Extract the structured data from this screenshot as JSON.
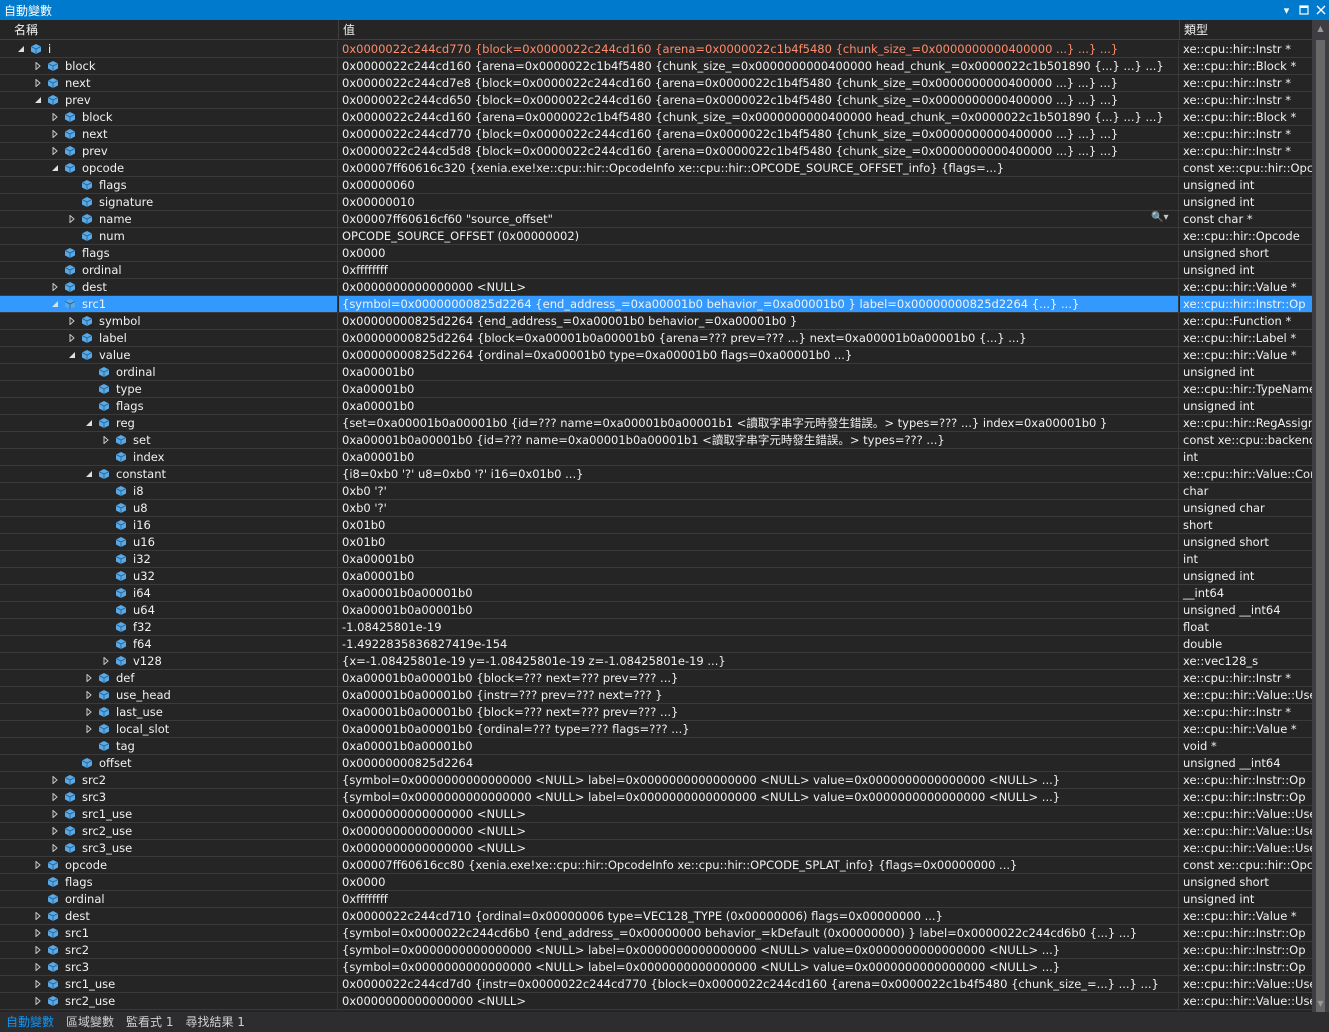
{
  "window": {
    "title": "自動變數",
    "dropdown_glyph": "▾",
    "restore_glyph": "▢",
    "close_glyph": "✕"
  },
  "columns": {
    "name": "名稱",
    "value": "值",
    "type": "類型"
  },
  "tabs": [
    {
      "label": "自動變數",
      "active": true
    },
    {
      "label": "區域變數",
      "active": false
    },
    {
      "label": "監看式 1",
      "active": false
    },
    {
      "label": "尋找結果 1",
      "active": false
    }
  ],
  "rows": [
    {
      "depth": 0,
      "exp": "open",
      "name": "i",
      "value": "0x0000022c244cd770 {block=0x0000022c244cd160 {arena=0x0000022c1b4f5480 {chunk_size_=0x0000000000400000 ...} ...} ...}",
      "type": "xe::cpu::hir::Instr *",
      "hl": true
    },
    {
      "depth": 1,
      "exp": "closed",
      "name": "block",
      "value": "0x0000022c244cd160 {arena=0x0000022c1b4f5480 {chunk_size_=0x0000000000400000 head_chunk_=0x0000022c1b501890 {...} ...} ...}",
      "type": "xe::cpu::hir::Block *"
    },
    {
      "depth": 1,
      "exp": "closed",
      "name": "next",
      "value": "0x0000022c244cd7e8 {block=0x0000022c244cd160 {arena=0x0000022c1b4f5480 {chunk_size_=0x0000000000400000 ...} ...} ...}",
      "type": "xe::cpu::hir::Instr *"
    },
    {
      "depth": 1,
      "exp": "open",
      "name": "prev",
      "value": "0x0000022c244cd650 {block=0x0000022c244cd160 {arena=0x0000022c1b4f5480 {chunk_size_=0x0000000000400000 ...} ...} ...}",
      "type": "xe::cpu::hir::Instr *"
    },
    {
      "depth": 2,
      "exp": "closed",
      "name": "block",
      "value": "0x0000022c244cd160 {arena=0x0000022c1b4f5480 {chunk_size_=0x0000000000400000 head_chunk_=0x0000022c1b501890 {...} ...} ...}",
      "type": "xe::cpu::hir::Block *"
    },
    {
      "depth": 2,
      "exp": "closed",
      "name": "next",
      "value": "0x0000022c244cd770 {block=0x0000022c244cd160 {arena=0x0000022c1b4f5480 {chunk_size_=0x0000000000400000 ...} ...} ...}",
      "type": "xe::cpu::hir::Instr *"
    },
    {
      "depth": 2,
      "exp": "closed",
      "name": "prev",
      "value": "0x0000022c244cd5d8 {block=0x0000022c244cd160 {arena=0x0000022c1b4f5480 {chunk_size_=0x0000000000400000 ...} ...} ...}",
      "type": "xe::cpu::hir::Instr *"
    },
    {
      "depth": 2,
      "exp": "open",
      "name": "opcode",
      "value": "0x00007ff60616c320 {xenia.exe!xe::cpu::hir::OpcodeInfo xe::cpu::hir::OPCODE_SOURCE_OFFSET_info} {flags=...}",
      "type": "const xe::cpu::hir::Opco"
    },
    {
      "depth": 3,
      "exp": "none",
      "name": "flags",
      "value": "0x00000060",
      "type": "unsigned int"
    },
    {
      "depth": 3,
      "exp": "none",
      "name": "signature",
      "value": "0x00000010",
      "type": "unsigned int"
    },
    {
      "depth": 3,
      "exp": "closed",
      "name": "name",
      "value": "0x00007ff60616cf60 \"source_offset\"",
      "type": "const char *",
      "mag": "🔍▾"
    },
    {
      "depth": 3,
      "exp": "none",
      "name": "num",
      "value": "OPCODE_SOURCE_OFFSET (0x00000002)",
      "type": "xe::cpu::hir::Opcode"
    },
    {
      "depth": 2,
      "exp": "none",
      "name": "flags",
      "value": "0x0000",
      "type": "unsigned short"
    },
    {
      "depth": 2,
      "exp": "none",
      "name": "ordinal",
      "value": "0xffffffff",
      "type": "unsigned int"
    },
    {
      "depth": 2,
      "exp": "closed",
      "name": "dest",
      "value": "0x0000000000000000 <NULL>",
      "type": "xe::cpu::hir::Value *"
    },
    {
      "depth": 2,
      "exp": "open",
      "name": "src1",
      "value": "{symbol=0x00000000825d2264 {end_address_=0xa00001b0 behavior_=0xa00001b0 } label=0x00000000825d2264 {...} ...}",
      "type": "xe::cpu::hir::Instr::Op",
      "sel": true
    },
    {
      "depth": 3,
      "exp": "closed",
      "name": "symbol",
      "value": "0x00000000825d2264 {end_address_=0xa00001b0 behavior_=0xa00001b0 }",
      "type": "xe::cpu::Function *"
    },
    {
      "depth": 3,
      "exp": "closed",
      "name": "label",
      "value": "0x00000000825d2264 {block=0xa00001b0a00001b0 {arena=??? prev=??? ...} next=0xa00001b0a00001b0 {...} ...}",
      "type": "xe::cpu::hir::Label *"
    },
    {
      "depth": 3,
      "exp": "open",
      "name": "value",
      "value": "0x00000000825d2264 {ordinal=0xa00001b0 type=0xa00001b0 flags=0xa00001b0 ...}",
      "type": "xe::cpu::hir::Value *"
    },
    {
      "depth": 4,
      "exp": "none",
      "name": "ordinal",
      "value": "0xa00001b0",
      "type": "unsigned int"
    },
    {
      "depth": 4,
      "exp": "none",
      "name": "type",
      "value": "0xa00001b0",
      "type": "xe::cpu::hir::TypeName"
    },
    {
      "depth": 4,
      "exp": "none",
      "name": "flags",
      "value": "0xa00001b0",
      "type": "unsigned int"
    },
    {
      "depth": 4,
      "exp": "open",
      "name": "reg",
      "value": "{set=0xa00001b0a00001b0 {id=??? name=0xa00001b0a00001b1 <讀取字串字元時發生錯誤。> types=??? ...} index=0xa00001b0 }",
      "type": "xe::cpu::hir::RegAssignm"
    },
    {
      "depth": 5,
      "exp": "closed",
      "name": "set",
      "value": "0xa00001b0a00001b0 {id=??? name=0xa00001b0a00001b1 <讀取字串字元時發生錯誤。> types=??? ...}",
      "type": "const xe::cpu::backend::"
    },
    {
      "depth": 5,
      "exp": "none",
      "name": "index",
      "value": "0xa00001b0",
      "type": "int"
    },
    {
      "depth": 4,
      "exp": "open",
      "name": "constant",
      "value": "{i8=0xb0 '?' u8=0xb0 '?' i16=0x01b0 ...}",
      "type": "xe::cpu::hir::Value::Const"
    },
    {
      "depth": 5,
      "exp": "none",
      "name": "i8",
      "value": "0xb0 '?'",
      "type": "char"
    },
    {
      "depth": 5,
      "exp": "none",
      "name": "u8",
      "value": "0xb0 '?'",
      "type": "unsigned char"
    },
    {
      "depth": 5,
      "exp": "none",
      "name": "i16",
      "value": "0x01b0",
      "type": "short"
    },
    {
      "depth": 5,
      "exp": "none",
      "name": "u16",
      "value": "0x01b0",
      "type": "unsigned short"
    },
    {
      "depth": 5,
      "exp": "none",
      "name": "i32",
      "value": "0xa00001b0",
      "type": "int"
    },
    {
      "depth": 5,
      "exp": "none",
      "name": "u32",
      "value": "0xa00001b0",
      "type": "unsigned int"
    },
    {
      "depth": 5,
      "exp": "none",
      "name": "i64",
      "value": "0xa00001b0a00001b0",
      "type": "__int64"
    },
    {
      "depth": 5,
      "exp": "none",
      "name": "u64",
      "value": "0xa00001b0a00001b0",
      "type": "unsigned __int64"
    },
    {
      "depth": 5,
      "exp": "none",
      "name": "f32",
      "value": "-1.08425801e-19",
      "type": "float"
    },
    {
      "depth": 5,
      "exp": "none",
      "name": "f64",
      "value": "-1.4922835836827419e-154",
      "type": "double"
    },
    {
      "depth": 5,
      "exp": "closed",
      "name": "v128",
      "value": "{x=-1.08425801e-19 y=-1.08425801e-19 z=-1.08425801e-19 ...}",
      "type": "xe::vec128_s"
    },
    {
      "depth": 4,
      "exp": "closed",
      "name": "def",
      "value": "0xa00001b0a00001b0 {block=??? next=??? prev=??? ...}",
      "type": "xe::cpu::hir::Instr *"
    },
    {
      "depth": 4,
      "exp": "closed",
      "name": "use_head",
      "value": "0xa00001b0a00001b0 {instr=??? prev=??? next=??? }",
      "type": "xe::cpu::hir::Value::Use_s"
    },
    {
      "depth": 4,
      "exp": "closed",
      "name": "last_use",
      "value": "0xa00001b0a00001b0 {block=??? next=??? prev=??? ...}",
      "type": "xe::cpu::hir::Instr *"
    },
    {
      "depth": 4,
      "exp": "closed",
      "name": "local_slot",
      "value": "0xa00001b0a00001b0 {ordinal=??? type=??? flags=??? ...}",
      "type": "xe::cpu::hir::Value *"
    },
    {
      "depth": 4,
      "exp": "none",
      "name": "tag",
      "value": "0xa00001b0a00001b0",
      "type": "void *"
    },
    {
      "depth": 3,
      "exp": "none",
      "name": "offset",
      "value": "0x00000000825d2264",
      "type": "unsigned __int64"
    },
    {
      "depth": 2,
      "exp": "closed",
      "name": "src2",
      "value": "{symbol=0x0000000000000000 <NULL> label=0x0000000000000000 <NULL> value=0x0000000000000000 <NULL> ...}",
      "type": "xe::cpu::hir::Instr::Op"
    },
    {
      "depth": 2,
      "exp": "closed",
      "name": "src3",
      "value": "{symbol=0x0000000000000000 <NULL> label=0x0000000000000000 <NULL> value=0x0000000000000000 <NULL> ...}",
      "type": "xe::cpu::hir::Instr::Op"
    },
    {
      "depth": 2,
      "exp": "closed",
      "name": "src1_use",
      "value": "0x0000000000000000 <NULL>",
      "type": "xe::cpu::hir::Value::Use_s"
    },
    {
      "depth": 2,
      "exp": "closed",
      "name": "src2_use",
      "value": "0x0000000000000000 <NULL>",
      "type": "xe::cpu::hir::Value::Use_s"
    },
    {
      "depth": 2,
      "exp": "closed",
      "name": "src3_use",
      "value": "0x0000000000000000 <NULL>",
      "type": "xe::cpu::hir::Value::Use_s"
    },
    {
      "depth": 1,
      "exp": "closed",
      "name": "opcode",
      "value": "0x00007ff60616cc80 {xenia.exe!xe::cpu::hir::OpcodeInfo xe::cpu::hir::OPCODE_SPLAT_info} {flags=0x00000000 ...}",
      "type": "const xe::cpu::hir::Opco"
    },
    {
      "depth": 1,
      "exp": "none",
      "name": "flags",
      "value": "0x0000",
      "type": "unsigned short"
    },
    {
      "depth": 1,
      "exp": "none",
      "name": "ordinal",
      "value": "0xffffffff",
      "type": "unsigned int"
    },
    {
      "depth": 1,
      "exp": "closed",
      "name": "dest",
      "value": "0x0000022c244cd710 {ordinal=0x00000006 type=VEC128_TYPE (0x00000006) flags=0x00000000 ...}",
      "type": "xe::cpu::hir::Value *"
    },
    {
      "depth": 1,
      "exp": "closed",
      "name": "src1",
      "value": "{symbol=0x0000022c244cd6b0 {end_address_=0x00000000 behavior_=kDefault (0x00000000) } label=0x0000022c244cd6b0 {...} ...}",
      "type": "xe::cpu::hir::Instr::Op"
    },
    {
      "depth": 1,
      "exp": "closed",
      "name": "src2",
      "value": "{symbol=0x0000000000000000 <NULL> label=0x0000000000000000 <NULL> value=0x0000000000000000 <NULL> ...}",
      "type": "xe::cpu::hir::Instr::Op"
    },
    {
      "depth": 1,
      "exp": "closed",
      "name": "src3",
      "value": "{symbol=0x0000000000000000 <NULL> label=0x0000000000000000 <NULL> value=0x0000000000000000 <NULL> ...}",
      "type": "xe::cpu::hir::Instr::Op"
    },
    {
      "depth": 1,
      "exp": "closed",
      "name": "src1_use",
      "value": "0x0000022c244cd7d0 {instr=0x0000022c244cd770 {block=0x0000022c244cd160 {arena=0x0000022c1b4f5480 {chunk_size_=...} ...} ...}",
      "type": "xe::cpu::hir::Value::Use_s"
    },
    {
      "depth": 1,
      "exp": "closed",
      "name": "src2_use",
      "value": "0x0000000000000000 <NULL>",
      "type": "xe::cpu::hir::Value::Use_s"
    }
  ],
  "colors": {
    "accent": "#007acc",
    "selection": "#3399ff",
    "changed_value": "#ff8c6b",
    "field_icon": "#5aa9e6"
  }
}
